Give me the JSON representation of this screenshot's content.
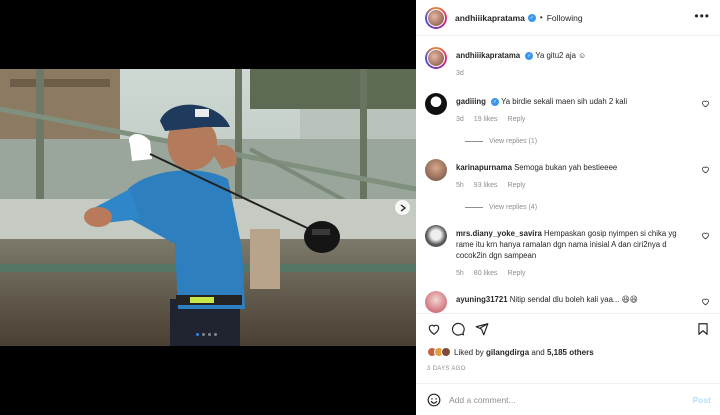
{
  "post": {
    "author": "andhiiikapratama",
    "follow_state": "Following",
    "caption": "Ya gitu2 aja ☺",
    "caption_time": "3d",
    "media_dots": 4,
    "active_dot": 0
  },
  "comments": [
    {
      "user": "gadiiing",
      "text": "Ya birdie sekali maen sih udah 2 kali",
      "time": "3d",
      "likes": "19 likes",
      "reply": "Reply",
      "view_replies": "View replies (1)"
    },
    {
      "user": "karinapurnama",
      "text": "Semoga bukan yah bestieeee",
      "time": "5h",
      "likes": "93 likes",
      "reply": "Reply",
      "view_replies": "View replies (4)"
    },
    {
      "user": "mrs.diany_yoke_savira",
      "text": "Hempaskan gosip nyimpen si chika yg rame itu krn hanya ramalan dgn nama inisial A dan ciri2nya d cocok2in dgn sampean",
      "time": "5h",
      "likes": "80 likes",
      "reply": "Reply"
    },
    {
      "user": "ayuning31721",
      "text": "Nitip sendal dlu boleh kali yaa... 😆😆"
    }
  ],
  "likes": {
    "liked_by_label": "Liked by",
    "liked_by_user": "gilangdirga",
    "and_label": "and",
    "others": "5,185 others"
  },
  "date": "3 DAYS AGO",
  "add_comment": {
    "placeholder": "Add a comment...",
    "post_label": "Post"
  },
  "icons": {
    "more": "more-options-icon",
    "heart": "heart-icon",
    "comment": "comment-icon",
    "share": "share-icon",
    "save": "bookmark-icon",
    "emoji": "emoji-icon",
    "next": "chevron-right-icon"
  },
  "colors": {
    "verified": "#3897f0",
    "dot_active": "#2f80ed",
    "post_disabled": "#b2dffc"
  }
}
